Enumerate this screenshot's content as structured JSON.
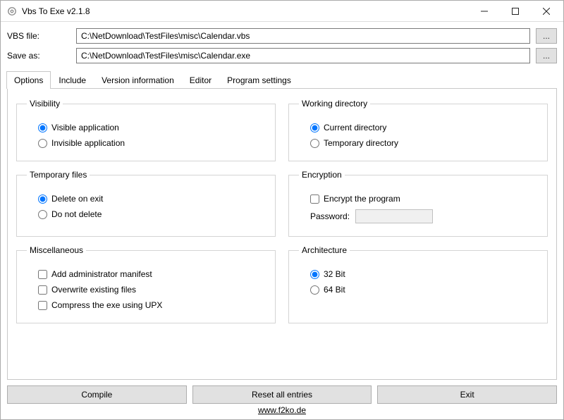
{
  "titlebar": {
    "title": "Vbs To Exe v2.1.8"
  },
  "file": {
    "vbs_label": "VBS file:",
    "vbs_value": "C:\\NetDownload\\TestFiles\\misc\\Calendar.vbs",
    "save_label": "Save as:",
    "save_value": "C:\\NetDownload\\TestFiles\\misc\\Calendar.exe",
    "browse": "..."
  },
  "tabs": {
    "options": "Options",
    "include": "Include",
    "version": "Version information",
    "editor": "Editor",
    "program": "Program settings"
  },
  "groups": {
    "visibility": {
      "legend": "Visibility",
      "visible": "Visible application",
      "invisible": "Invisible application"
    },
    "workdir": {
      "legend": "Working directory",
      "current": "Current directory",
      "temp": "Temporary directory"
    },
    "tempfiles": {
      "legend": "Temporary files",
      "delete": "Delete on exit",
      "keep": "Do not delete"
    },
    "encryption": {
      "legend": "Encryption",
      "encrypt": "Encrypt the program",
      "password_label": "Password:"
    },
    "misc": {
      "legend": "Miscellaneous",
      "admin": "Add administrator manifest",
      "overwrite": "Overwrite existing files",
      "upx": "Compress the exe using UPX"
    },
    "arch": {
      "legend": "Architecture",
      "b32": "32 Bit",
      "b64": "64 Bit"
    }
  },
  "buttons": {
    "compile": "Compile",
    "reset": "Reset all entries",
    "exit": "Exit"
  },
  "footer_link": "www.f2ko.de"
}
